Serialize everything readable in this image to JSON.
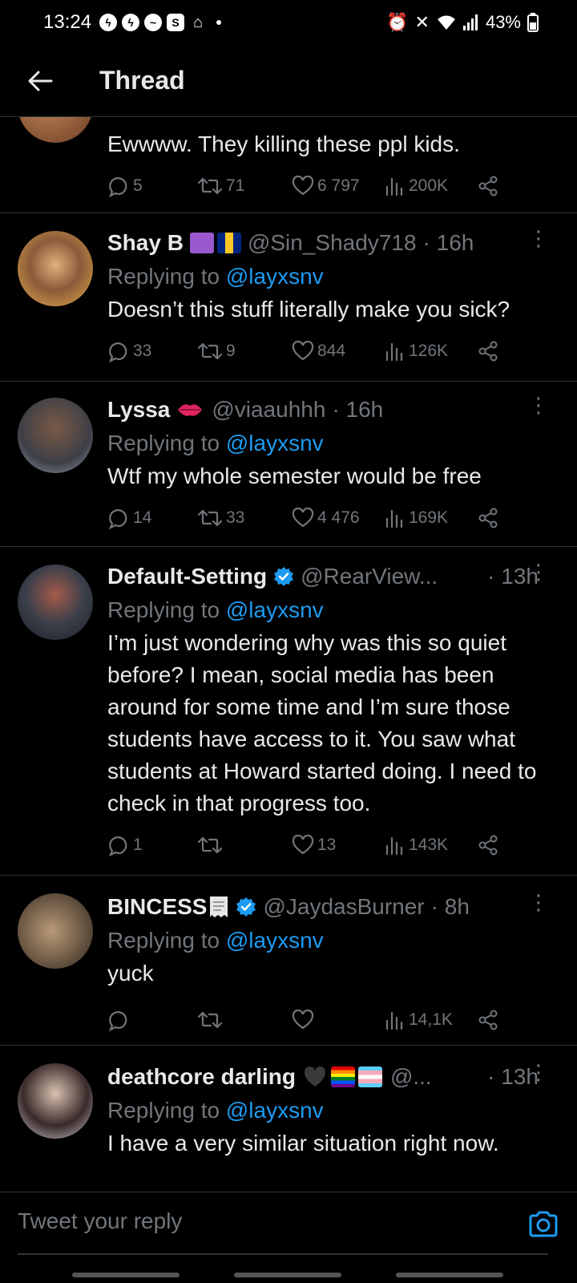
{
  "status_bar": {
    "time": "13:24",
    "battery": "43%"
  },
  "header": {
    "title": "Thread"
  },
  "tweets": [
    {
      "name": "",
      "handle": "",
      "time": "",
      "text": "Ewwww. They killing these ppl kids.",
      "replies": "5",
      "retweets": "71",
      "likes": "6 797",
      "views": "200K"
    },
    {
      "name": "Shay B",
      "handle": "@Sin_Shady718",
      "time": "· 16h",
      "replying_prefix": "Replying to ",
      "replying_to": "@layxsnv",
      "text": "Doesn’t this stuff literally make you sick?",
      "replies": "33",
      "retweets": "9",
      "likes": "844",
      "views": "126K"
    },
    {
      "name": "Lyssa",
      "handle": "@viaauhhh",
      "time": "· 16h",
      "replying_prefix": "Replying to ",
      "replying_to": "@layxsnv",
      "text": "Wtf my whole semester would be free",
      "replies": "14",
      "retweets": "33",
      "likes": "4 476",
      "views": "169K"
    },
    {
      "name": "Default-Setting",
      "handle": "@RearView...",
      "time": "· 13h",
      "replying_prefix": "Replying to ",
      "replying_to": "@layxsnv",
      "text": "I’m just wondering why was this so quiet before? I mean, social media has been around for some time and I’m sure those students have access to it. You saw what students at Howard started doing. I need to check in that progress too.",
      "replies": "1",
      "retweets": "",
      "likes": "13",
      "views": "143K"
    },
    {
      "name": "BINCESS",
      "handle": "@JaydasBurner",
      "time": "· 8h",
      "replying_prefix": "Replying to ",
      "replying_to": "@layxsnv",
      "text": "yuck",
      "replies": "",
      "retweets": "",
      "likes": "",
      "views": "14,1K"
    },
    {
      "name": "deathcore darling",
      "handle": "@...",
      "time": "· 13h",
      "replying_prefix": "Replying to ",
      "replying_to": "@layxsnv",
      "text": "I have a very similar situation right now."
    }
  ],
  "reply_bar": {
    "placeholder": "Tweet your reply"
  },
  "colors": {
    "accent": "#1d9bf0",
    "muted": "#71767b",
    "text": "#e7e9ea",
    "verified": "#1d9bf0"
  }
}
